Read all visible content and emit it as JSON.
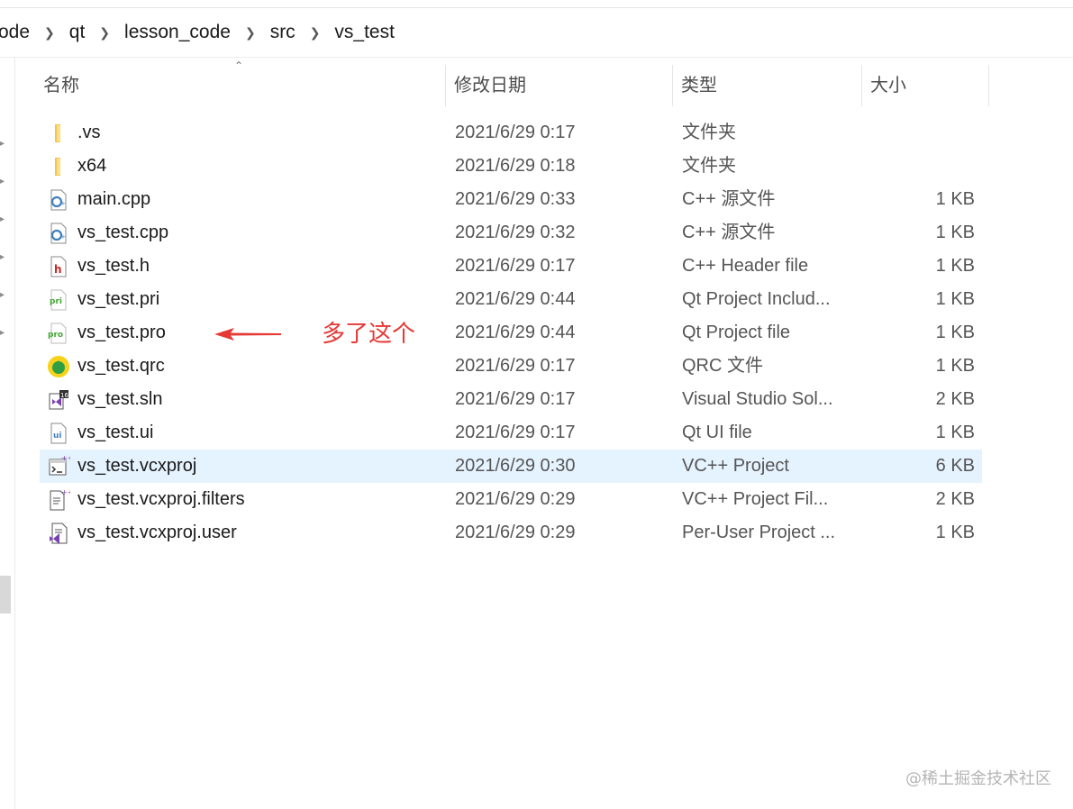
{
  "breadcrumb": [
    "ode",
    "qt",
    "lesson_code",
    "src",
    "vs_test"
  ],
  "columns": {
    "name": "名称",
    "modified": "修改日期",
    "type": "类型",
    "size": "大小"
  },
  "files": [
    {
      "name": ".vs",
      "modified": "2021/6/29 0:17",
      "type": "文件夹",
      "size": "",
      "icon": "folder-icon"
    },
    {
      "name": "x64",
      "modified": "2021/6/29 0:18",
      "type": "文件夹",
      "size": "",
      "icon": "folder-icon"
    },
    {
      "name": "main.cpp",
      "modified": "2021/6/29 0:33",
      "type": "C++ 源文件",
      "size": "1 KB",
      "icon": "cpp-file-icon"
    },
    {
      "name": "vs_test.cpp",
      "modified": "2021/6/29 0:32",
      "type": "C++ 源文件",
      "size": "1 KB",
      "icon": "cpp-file-icon"
    },
    {
      "name": "vs_test.h",
      "modified": "2021/6/29 0:17",
      "type": "C++ Header file",
      "size": "1 KB",
      "icon": "header-file-icon"
    },
    {
      "name": "vs_test.pri",
      "modified": "2021/6/29 0:44",
      "type": "Qt Project Includ...",
      "size": "1 KB",
      "icon": "pri-file-icon"
    },
    {
      "name": "vs_test.pro",
      "modified": "2021/6/29 0:44",
      "type": "Qt Project file",
      "size": "1 KB",
      "icon": "pro-file-icon"
    },
    {
      "name": "vs_test.qrc",
      "modified": "2021/6/29 0:17",
      "type": "QRC 文件",
      "size": "1 KB",
      "icon": "qrc-file-icon"
    },
    {
      "name": "vs_test.sln",
      "modified": "2021/6/29 0:17",
      "type": "Visual Studio Sol...",
      "size": "2 KB",
      "icon": "sln-file-icon"
    },
    {
      "name": "vs_test.ui",
      "modified": "2021/6/29 0:17",
      "type": "Qt UI file",
      "size": "1 KB",
      "icon": "ui-file-icon"
    },
    {
      "name": "vs_test.vcxproj",
      "modified": "2021/6/29 0:30",
      "type": "VC++ Project",
      "size": "6 KB",
      "icon": "vcxproj-file-icon",
      "selected": true
    },
    {
      "name": "vs_test.vcxproj.filters",
      "modified": "2021/6/29 0:29",
      "type": "VC++ Project Fil...",
      "size": "2 KB",
      "icon": "filters-file-icon"
    },
    {
      "name": "vs_test.vcxproj.user",
      "modified": "2021/6/29 0:29",
      "type": "Per-User Project ...",
      "size": "1 KB",
      "icon": "user-file-icon"
    }
  ],
  "annotation": {
    "text": "多了这个",
    "color": "#e53935"
  },
  "watermark": "@稀土掘金技术社区",
  "colors": {
    "selected_row": "#e5f3ff",
    "folder": "#f7c94f"
  }
}
